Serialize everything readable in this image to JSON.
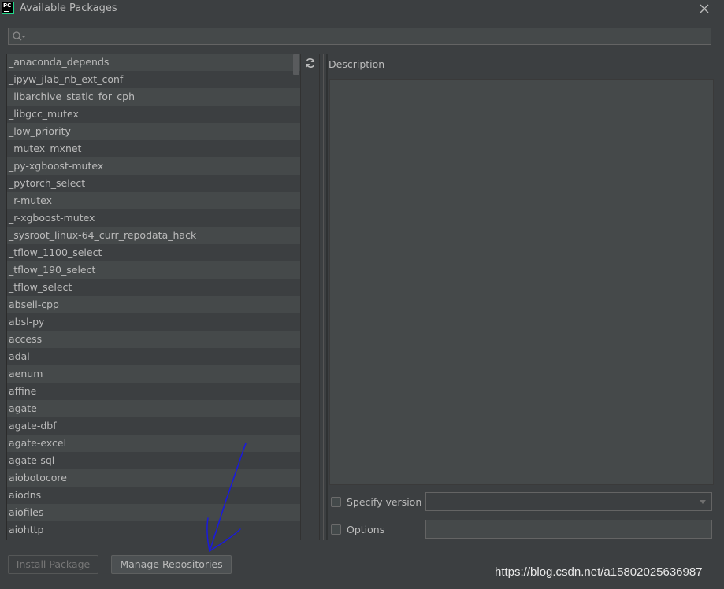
{
  "window": {
    "title": "Available Packages",
    "app_icon_text": "PC"
  },
  "search": {
    "value": "",
    "placeholder": ""
  },
  "packages": [
    "_anaconda_depends",
    "_ipyw_jlab_nb_ext_conf",
    "_libarchive_static_for_cph",
    "_libgcc_mutex",
    "_low_priority",
    "_mutex_mxnet",
    "_py-xgboost-mutex",
    "_pytorch_select",
    "_r-mutex",
    "_r-xgboost-mutex",
    "_sysroot_linux-64_curr_repodata_hack",
    "_tflow_1100_select",
    "_tflow_190_select",
    "_tflow_select",
    "abseil-cpp",
    "absl-py",
    "access",
    "adal",
    "aenum",
    "affine",
    "agate",
    "agate-dbf",
    "agate-excel",
    "agate-sql",
    "aiobotocore",
    "aiodns",
    "aiofiles",
    "aiohttp"
  ],
  "description": {
    "label": "Description",
    "content": ""
  },
  "options": {
    "specify_version_label": "Specify version",
    "specify_version_checked": false,
    "version_value": "",
    "options_label": "Options",
    "options_checked": false,
    "options_value": ""
  },
  "buttons": {
    "install_label": "Install Package",
    "manage_label": "Manage Repositories"
  },
  "watermark": "https://blog.csdn.net/a15802025636987",
  "colors": {
    "background": "#3c3f41",
    "row_alt": "#45494a",
    "text": "#bbbbbb",
    "annotation": "#1a1adb"
  }
}
